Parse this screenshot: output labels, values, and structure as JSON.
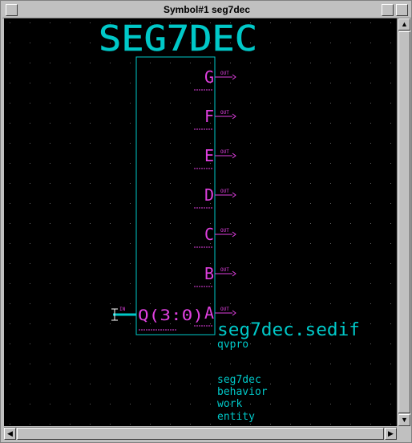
{
  "window": {
    "title": "Symbol#1 seg7dec"
  },
  "symbol": {
    "name": "SEG7DEC",
    "outputs": [
      {
        "label": "G",
        "dir": "OUT"
      },
      {
        "label": "F",
        "dir": "OUT"
      },
      {
        "label": "E",
        "dir": "OUT"
      },
      {
        "label": "D",
        "dir": "OUT"
      },
      {
        "label": "C",
        "dir": "OUT"
      },
      {
        "label": "B",
        "dir": "OUT"
      },
      {
        "label": "A",
        "dir": "OUT"
      }
    ],
    "input": {
      "label": "Q(3:0)",
      "dir": "IN"
    },
    "file": "seg7dec.sedif",
    "tool": "qvpro",
    "info": [
      "seg7dec",
      "behavior",
      "work",
      "entity"
    ]
  },
  "colors": {
    "box": "#00c8c8",
    "pins": "#e040e0",
    "info": "#00c8c8",
    "grid": "#606060",
    "canvas": "#000000"
  },
  "scrollbars": {
    "up_icon": "arrow-up-icon",
    "down_icon": "arrow-down-icon",
    "left_icon": "arrow-left-icon",
    "right_icon": "arrow-right-icon"
  }
}
